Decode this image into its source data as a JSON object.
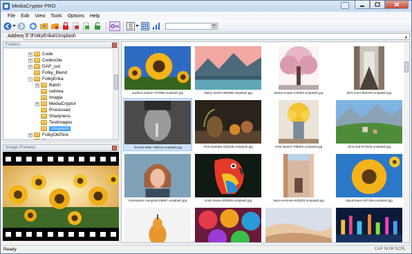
{
  "window": {
    "title": "MediaCryptor PRO"
  },
  "menu": [
    "File",
    "Edit",
    "View",
    "Tools",
    "Options",
    "Help"
  ],
  "address": {
    "label": "Address",
    "value": "E:\\FotkyErika\\Unsplash"
  },
  "folders_pane": {
    "title": "Folders",
    "items": [
      {
        "label": "Code",
        "level": 2,
        "expander": "+"
      },
      {
        "label": "Codescite",
        "level": 2,
        "expander": "+"
      },
      {
        "label": "DAP_out",
        "level": 2,
        "expander": "+"
      },
      {
        "label": "Fotky_Blend",
        "level": 2,
        "expander": ""
      },
      {
        "label": "FotkyErika",
        "level": 2,
        "expander": "−"
      },
      {
        "label": "Batch",
        "level": 3,
        "expander": "+"
      },
      {
        "label": "celinea",
        "level": 3,
        "expander": ""
      },
      {
        "label": "Imagia",
        "level": 3,
        "expander": ""
      },
      {
        "label": "MediaCryptor",
        "level": 3,
        "expander": "+"
      },
      {
        "label": "Processed",
        "level": 3,
        "expander": ""
      },
      {
        "label": "Sharpness",
        "level": 3,
        "expander": ""
      },
      {
        "label": "TestImages",
        "level": 3,
        "expander": ""
      },
      {
        "label": "Unsplash",
        "level": 3,
        "expander": "",
        "selected": true
      },
      {
        "label": "FotkyOldTest",
        "level": 2,
        "expander": "+"
      },
      {
        "label": "Fotkytest",
        "level": 2,
        "expander": "+"
      }
    ]
  },
  "preview_pane": {
    "title": "Image Preview"
  },
  "gallery": {
    "thumbnails": [
      {
        "caption": "audrius-sutkus-737089-unsplash.jpg",
        "scene": "sunflower",
        "selected": false
      },
      {
        "caption": "bailey-zindel-396398-unsplash.jpg",
        "scene": "mountain-lake",
        "selected": false
      },
      {
        "caption": "banter-snaps-249352-unsplash.jpg",
        "scene": "blossom-tree",
        "selected": false
      },
      {
        "caption": "biel-morro-852293-unsplash.jpg",
        "scene": "street",
        "selected": false
      },
      {
        "caption": "bonnie-kittle-784018-unsplash.jpg",
        "scene": "portrait-bw",
        "selected": true
      },
      {
        "caption": "chris-barbalis-625236-unsplash.jpg",
        "scene": "still-life",
        "selected": false
      },
      {
        "caption": "chris-lawton-789082-unsplash.jpg",
        "scene": "flower-vase",
        "selected": false
      },
      {
        "caption": "chris-ried-972646-unsplash.jpg",
        "scene": "alpine-village",
        "selected": false
      },
      {
        "caption": "christopher-campbell-28567-unsplash.jpg",
        "scene": "woman-portrait",
        "selected": false
      },
      {
        "caption": "cmdr-shane-626506-unsplash.jpg",
        "scene": "parrot",
        "selected": false
      },
      {
        "caption": "dario-veronesi-426322-unsplash.jpg",
        "scene": "alley",
        "selected": false
      },
      {
        "caption": "david-travis-537185-unsplash.jpg",
        "scene": "sunflower-close",
        "selected": false
      },
      {
        "caption": "",
        "scene": "pear",
        "selected": false
      },
      {
        "caption": "",
        "scene": "roses",
        "selected": false
      },
      {
        "caption": "",
        "scene": "desert",
        "selected": false
      },
      {
        "caption": "",
        "scene": "city-night",
        "selected": false
      }
    ]
  },
  "status": {
    "left": "Ready",
    "right": "CAP  NUM  SCRL"
  },
  "colors": {
    "accent": "#3399ff",
    "selection": "#cde3fa"
  }
}
